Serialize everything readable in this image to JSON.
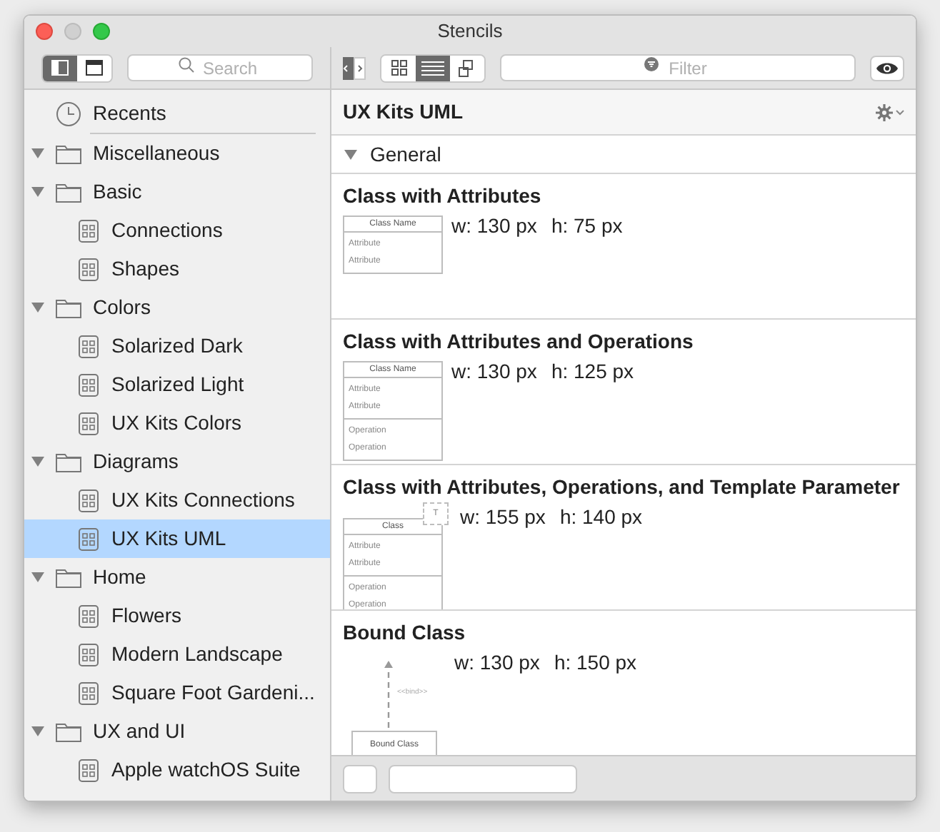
{
  "window": {
    "title": "Stencils"
  },
  "sidebar": {
    "layout_buttons": [
      {
        "kind": "sidebar",
        "selected": true
      },
      {
        "kind": "top",
        "selected": false
      }
    ],
    "search": {
      "placeholder": "Search"
    },
    "items": [
      {
        "kind": "recent",
        "label": "Recents",
        "selected": false
      },
      {
        "kind": "folder",
        "label": "Miscellaneous",
        "expanded": true,
        "selected": false
      },
      {
        "kind": "folder",
        "label": "Basic",
        "expanded": true,
        "selected": false,
        "children": [
          {
            "kind": "stencil",
            "label": "Connections",
            "selected": false
          },
          {
            "kind": "stencil",
            "label": "Shapes",
            "selected": false
          }
        ]
      },
      {
        "kind": "folder",
        "label": "Colors",
        "expanded": true,
        "selected": false,
        "children": [
          {
            "kind": "stencil",
            "label": "Solarized Dark",
            "selected": false
          },
          {
            "kind": "stencil",
            "label": "Solarized Light",
            "selected": false
          },
          {
            "kind": "stencil",
            "label": "UX Kits Colors",
            "selected": false
          }
        ]
      },
      {
        "kind": "folder",
        "label": "Diagrams",
        "expanded": true,
        "selected": false,
        "children": [
          {
            "kind": "stencil",
            "label": "UX Kits Connections",
            "selected": false
          },
          {
            "kind": "stencil",
            "label": "UX Kits UML",
            "selected": true
          }
        ]
      },
      {
        "kind": "folder",
        "label": "Home",
        "expanded": true,
        "selected": false,
        "children": [
          {
            "kind": "stencil",
            "label": "Flowers",
            "selected": false
          },
          {
            "kind": "stencil",
            "label": "Modern Landscape",
            "selected": false
          },
          {
            "kind": "stencil",
            "label": "Square Foot Gardeni...",
            "selected": false
          }
        ]
      },
      {
        "kind": "folder",
        "label": "UX and UI",
        "expanded": true,
        "selected": false,
        "children": [
          {
            "kind": "stencil",
            "label": "Apple watchOS Suite",
            "selected": false
          }
        ]
      }
    ]
  },
  "toolbar": {
    "view_buttons": [
      {
        "kind": "grid",
        "selected": false
      },
      {
        "kind": "list",
        "selected": true
      },
      {
        "kind": "outline",
        "selected": false
      }
    ],
    "filter": {
      "placeholder": "Filter"
    }
  },
  "stencil": {
    "title": "UX Kits UML",
    "group": {
      "label": "General",
      "expanded": true
    },
    "shapes": [
      {
        "title": "Class with Attributes",
        "width": "w: 130 px",
        "height": "h: 75 px",
        "preview": {
          "kind": "class",
          "name": "Class Name",
          "attributes": [
            "Attribute",
            "Attribute"
          ]
        }
      },
      {
        "title": "Class with Attributes and Operations",
        "width": "w: 130 px",
        "height": "h: 125 px",
        "preview": {
          "kind": "class",
          "name": "Class Name",
          "attributes": [
            "Attribute",
            "Attribute"
          ],
          "operations": [
            "Operation",
            "Operation"
          ]
        }
      },
      {
        "title": "Class with Attributes, Operations, and Template Parameter",
        "width": "w: 155 px",
        "height": "h: 140 px",
        "preview": {
          "kind": "template",
          "name": "Class",
          "parameter": "T",
          "attributes": [
            "Attribute",
            "Attribute"
          ],
          "operations": [
            "Operation",
            "Operation"
          ]
        }
      },
      {
        "title": "Bound Class",
        "width": "w: 130 px",
        "height": "h: 150 px",
        "preview": {
          "kind": "bound",
          "name": "Bound Class",
          "relation": "<<bind>>"
        }
      }
    ]
  }
}
